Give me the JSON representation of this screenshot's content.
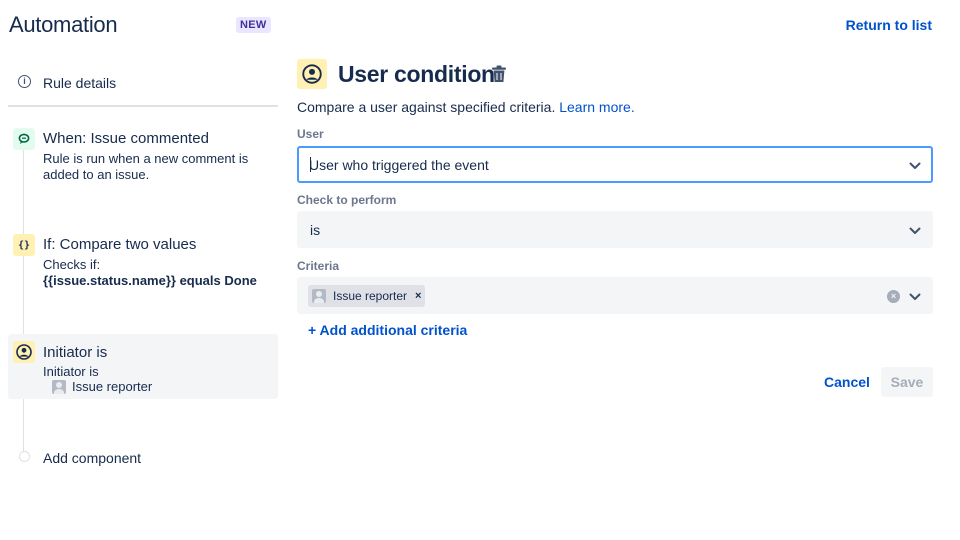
{
  "header": {
    "app_title": "Automation",
    "badge": "NEW",
    "return_link": "Return to list"
  },
  "sidebar": {
    "rule_details": "Rule details",
    "steps": [
      {
        "title": "When: Issue commented",
        "description": "Rule is run when a new comment is added to an issue.",
        "icon": "comment-icon"
      },
      {
        "title": "If: Compare two values",
        "description_prefix": "Checks if:",
        "description_code": "{{issue.status.name}} equals Done",
        "icon": "curly-braces-icon",
        "icon_text": "{}"
      },
      {
        "title": "Initiator is",
        "description": "Initiator is",
        "value": "Issue reporter",
        "icon": "user-icon"
      }
    ],
    "add_component": "Add component"
  },
  "main": {
    "title": "User condition",
    "description": "Compare a user against specified criteria.",
    "learn_more": "Learn more.",
    "user_label": "User",
    "user_value": "User who triggered the event",
    "check_label": "Check to perform",
    "check_value": "is",
    "criteria_label": "Criteria",
    "criteria_tag": "Issue reporter",
    "criteria_tag_remove": "×",
    "criteria_clear": "×",
    "add_criteria": "+ Add additional criteria",
    "cancel": "Cancel",
    "save": "Save"
  },
  "colors": {
    "link": "#0052cc",
    "focus_border": "#4c9aff",
    "yellow_icon_bg": "#fff0b3",
    "green_icon_bg": "#e3fcef",
    "badge_bg": "#eae6ff"
  }
}
